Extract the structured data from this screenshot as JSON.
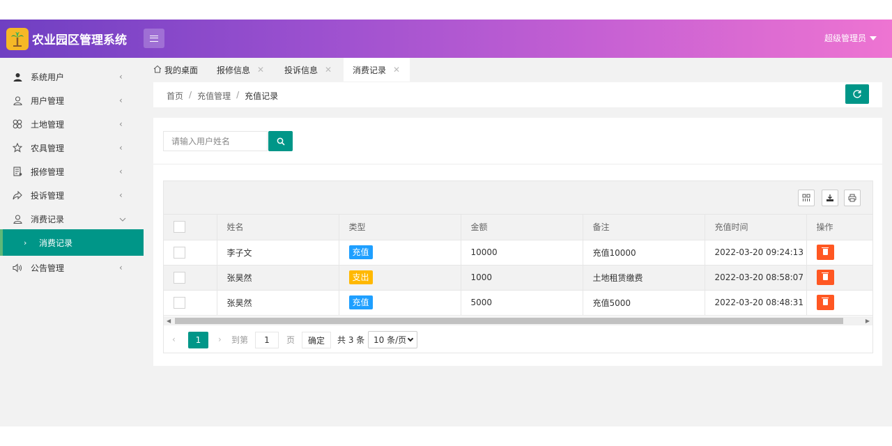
{
  "header": {
    "app_title": "农业园区管理系统",
    "user_label": "超级管理员",
    "brand_gradient": [
      "#6f3fc2",
      "#ee74d2"
    ]
  },
  "sidebar": {
    "items": [
      {
        "label": "系统用户",
        "icon": "user-solid-icon"
      },
      {
        "label": "用户管理",
        "icon": "user-outline-icon"
      },
      {
        "label": "土地管理",
        "icon": "clover-icon"
      },
      {
        "label": "农具管理",
        "icon": "star-outline-icon"
      },
      {
        "label": "报修管理",
        "icon": "form-icon"
      },
      {
        "label": "投诉管理",
        "icon": "share-icon"
      },
      {
        "label": "消费记录",
        "icon": "user-outline-icon"
      },
      {
        "label": "公告管理",
        "icon": "speaker-icon"
      }
    ],
    "sub_item": {
      "label": "消费记录"
    },
    "accent": "#009688"
  },
  "tabs": [
    {
      "label": "我的桌面"
    },
    {
      "label": "报修信息",
      "close": "✕"
    },
    {
      "label": "投诉信息",
      "close": "✕"
    },
    {
      "label": "消费记录",
      "close": "✕"
    }
  ],
  "breadcrumb": {
    "items": [
      "首页",
      "充值管理",
      "充值记录"
    ],
    "separator": "/"
  },
  "search": {
    "placeholder": "请输入用户姓名"
  },
  "table": {
    "columns": [
      "姓名",
      "类型",
      "金额",
      "备注",
      "充值时间",
      "操作"
    ],
    "rows": [
      {
        "name": "李子文",
        "type": "充值",
        "amount": "10000",
        "note": "充值10000",
        "time": "2022-03-20 09:24:13"
      },
      {
        "name": "张昊然",
        "type": "支出",
        "amount": "1000",
        "note": "土地租赁缴费",
        "time": "2022-03-20 08:58:07"
      },
      {
        "name": "张昊然",
        "type": "充值",
        "amount": "5000",
        "note": "充值5000",
        "time": "2022-03-20 08:48:31"
      }
    ],
    "type_colors": {
      "充值": "#1e9fff",
      "支出": "#ffb800"
    }
  },
  "pagination": {
    "prev": "‹",
    "current_page": "1",
    "next": "›",
    "goto_label": "到第",
    "goto_value": "1",
    "unit": "页",
    "confirm": "确定",
    "total": "共 3 条",
    "page_size": "10 条/页"
  }
}
